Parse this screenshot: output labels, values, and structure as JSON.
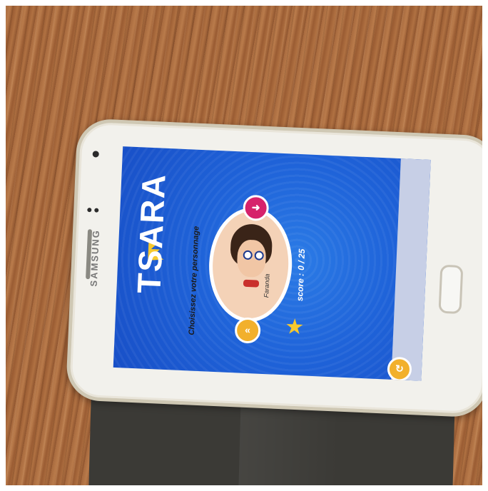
{
  "scene": {
    "surface": "wood-table",
    "device_brand": "SAMSUNG"
  },
  "app": {
    "title": "TSARA",
    "subtitle": "Choisissez votre personnage",
    "character_name": "Faranda",
    "score_label": "score :",
    "score_value": "0 / 25",
    "colors": {
      "screen_blue": "#1f63d9",
      "nav_left": "#f2b02c",
      "nav_right": "#d6226b",
      "star": "#f7c92d"
    },
    "icons": {
      "crown": "crown-icon",
      "star": "star-icon",
      "prev": "chevron-left-icon",
      "next": "arrow-next-icon",
      "action": "refresh-icon"
    }
  }
}
